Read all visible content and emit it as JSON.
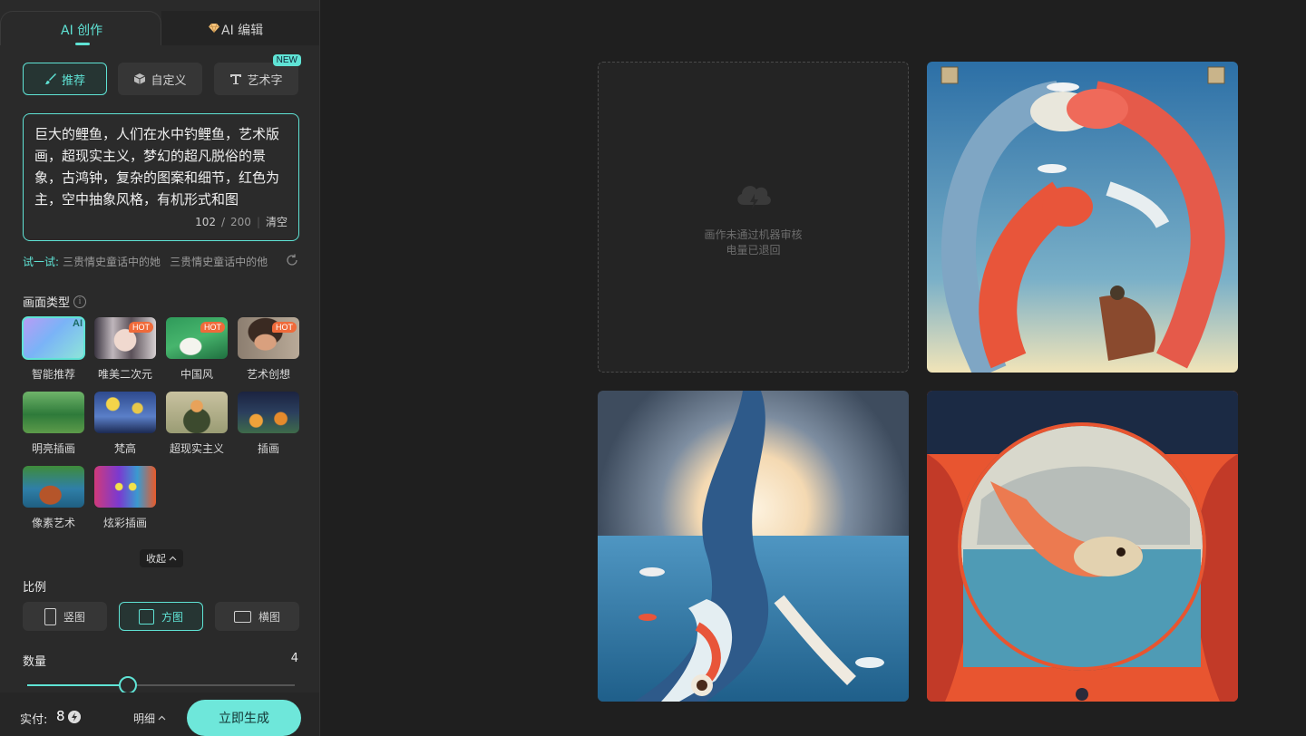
{
  "tabs": {
    "ai_create": "AI 创作",
    "ai_edit": "AI 编辑"
  },
  "modes": {
    "recommend": "推荐",
    "custom": "自定义",
    "art_text": "艺术字",
    "new_badge": "NEW"
  },
  "prompt": {
    "text": "巨大的鲤鱼，人们在水中钓鲤鱼，艺术版画，超现实主义，梦幻的超凡脱俗的景象，古鸿钟，复杂的图案和细节，红色为主，空中抽象风格，有机形式和图",
    "count": "102",
    "max": "200",
    "slash": "/",
    "clear": "清空"
  },
  "try": {
    "label": "试一试:",
    "suggestions": [
      "三贵情史童话中的她",
      "三贵情史童话中的他"
    ]
  },
  "style_section": {
    "title": "画面类型",
    "info": "i",
    "items": [
      {
        "label": "智能推荐",
        "badge": "AI"
      },
      {
        "label": "唯美二次元",
        "badge": "HOT"
      },
      {
        "label": "中国风",
        "badge": "HOT"
      },
      {
        "label": "艺术创想",
        "badge": "HOT"
      },
      {
        "label": "明亮插画",
        "badge": ""
      },
      {
        "label": "梵高",
        "badge": ""
      },
      {
        "label": "超现实主义",
        "badge": ""
      },
      {
        "label": "插画",
        "badge": ""
      },
      {
        "label": "像素艺术",
        "badge": ""
      },
      {
        "label": "炫彩插画",
        "badge": ""
      }
    ],
    "collapse": "收起"
  },
  "ratio": {
    "title": "比例",
    "options": [
      "竖图",
      "方图",
      "横图"
    ],
    "selected": "方图"
  },
  "quantity": {
    "title": "数量",
    "value": "4",
    "slider_fraction": 0.375
  },
  "footer": {
    "pay_label": "实付:",
    "pay_value": "8",
    "detail": "明细",
    "generate": "立即生成"
  },
  "gallery": {
    "failed_line1": "画作未通过机器审核",
    "failed_line2": "电量已退回"
  },
  "colors": {
    "accent": "#5fe3d5",
    "generate_button": "#6ee7da",
    "hot_badge": "#ef6a3a",
    "panel_bg": "#2a2a2a",
    "page_bg": "#1f1f1f"
  }
}
